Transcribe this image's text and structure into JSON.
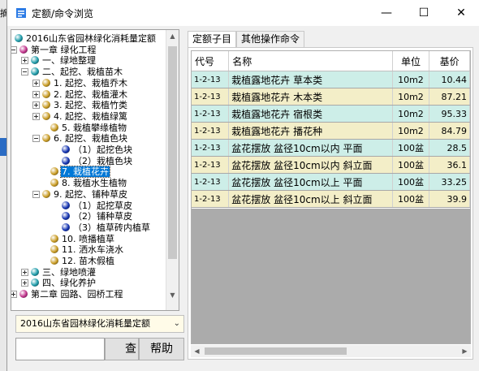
{
  "background": {
    "fragment_text": "摘"
  },
  "window": {
    "title": "定额/命令浏览",
    "minimize_glyph": "—",
    "maximize_glyph": "☐",
    "close_glyph": "✕"
  },
  "tree": {
    "rows": [
      {
        "label": "2016山东省园林绿化消耗量定额",
        "ball": "#1a9aa8"
      },
      {
        "label": "第一章  绿化工程",
        "ball": "#c0308a"
      },
      {
        "label": "一、绿地整理",
        "ball": "#1a9aa8"
      },
      {
        "label": "二、起挖、栽植苗木",
        "ball": "#1a9aa8"
      },
      {
        "label": "1. 起挖、栽植乔木",
        "ball": "#c89a20"
      },
      {
        "label": "2. 起挖、栽植灌木",
        "ball": "#c89a20"
      },
      {
        "label": "3. 起挖、栽植竹类",
        "ball": "#c89a20"
      },
      {
        "label": "4. 起挖、栽植绿篱",
        "ball": "#c89a20"
      },
      {
        "label": "5. 栽植攀缘植物",
        "ball": "#c89a20"
      },
      {
        "label": "6. 起挖、栽植色块",
        "ball": "#c89a20"
      },
      {
        "label": "（1）起挖色块",
        "ball": "#1030b0"
      },
      {
        "label": "（2）栽植色块",
        "ball": "#1030b0"
      },
      {
        "label": "7. 栽植花卉",
        "ball": "#c89a20"
      },
      {
        "label": "8. 栽植水生植物",
        "ball": "#c89a20"
      },
      {
        "label": "9. 起挖、铺种草皮",
        "ball": "#c89a20"
      },
      {
        "label": "（1）起挖草皮",
        "ball": "#1030b0"
      },
      {
        "label": "（2）铺种草皮",
        "ball": "#1030b0"
      },
      {
        "label": "（3）植草砖内植草",
        "ball": "#1030b0"
      },
      {
        "label": "10. 喷播植草",
        "ball": "#c89a20"
      },
      {
        "label": "11. 洒水车浇水",
        "ball": "#c89a20"
      },
      {
        "label": "12. 苗木假植",
        "ball": "#c89a20"
      },
      {
        "label": "三、绿地喷灌",
        "ball": "#1a9aa8"
      },
      {
        "label": "四、绿化养护",
        "ball": "#1a9aa8"
      },
      {
        "label": "第二章  园路、园桥工程",
        "ball": "#c0308a"
      }
    ]
  },
  "combo": {
    "value": "2016山东省园林绿化消耗量定额"
  },
  "search_button": {
    "label": "查"
  },
  "help_button": {
    "label": "帮助"
  },
  "tabs": [
    "定额子目",
    "其他操作命令"
  ],
  "table": {
    "headers": [
      "代号",
      "名称",
      "单位",
      "基价"
    ],
    "rows": [
      [
        "1-2-13",
        "栽植露地花卉  草本类",
        "10m2",
        "10.44"
      ],
      [
        "1-2-13",
        "栽植露地花卉  木本类",
        "10m2",
        "87.21"
      ],
      [
        "1-2-13",
        "栽植露地花卉  宿根类",
        "10m2",
        "95.33"
      ],
      [
        "1-2-13",
        "栽植露地花卉  播花种",
        "10m2",
        "84.79"
      ],
      [
        "1-2-13",
        "盆花摆放  盆径10cm以内  平面",
        "100盆",
        "28.5"
      ],
      [
        "1-2-13",
        "盆花摆放  盆径10cm以内  斜立面",
        "100盆",
        "36.1"
      ],
      [
        "1-2-13",
        "盆花摆放  盆径10cm以上  平面",
        "100盆",
        "33.25"
      ],
      [
        "1-2-13",
        "盆花摆放  盆径10cm以上  斜立面",
        "100盆",
        "39.9"
      ]
    ]
  },
  "colors": {
    "row_even": "#cdeee8",
    "row_odd": "#f3eec8",
    "selection": "#0078d7"
  }
}
